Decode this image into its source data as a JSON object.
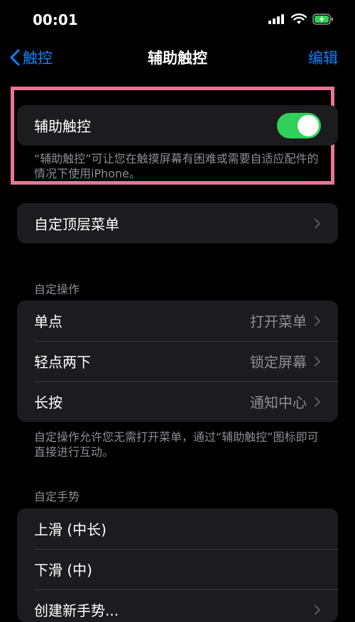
{
  "status_bar": {
    "time": "00:01",
    "icons": [
      "signal-icon",
      "wifi-icon",
      "battery-charging-icon"
    ],
    "battery_color": "#30d158"
  },
  "nav": {
    "back_label": "触控",
    "title": "辅助触控",
    "edit_label": "编辑"
  },
  "assistive_touch": {
    "label": "辅助触控",
    "enabled": true,
    "description": "“辅助触控”可让您在触摸屏幕有困难或需要自适应配件的情况下使用iPhone。"
  },
  "top_menu": {
    "label": "自定顶层菜单"
  },
  "custom_actions": {
    "header": "自定操作",
    "rows": [
      {
        "label": "单点",
        "value": "打开菜单"
      },
      {
        "label": "轻点两下",
        "value": "锁定屏幕"
      },
      {
        "label": "长按",
        "value": "通知中心"
      }
    ],
    "footer": "自定操作允许您无需打开菜单，通过“辅助触控”图标即可直接进行互动。"
  },
  "custom_gestures": {
    "header": "自定手势",
    "rows": [
      {
        "label": "上滑 (中长)"
      },
      {
        "label": "下滑 (中)"
      },
      {
        "label": "创建新手势..."
      }
    ]
  },
  "colors": {
    "accent": "#0a84ff",
    "toggle_on": "#30d158",
    "highlight_border": "#e97594",
    "group_bg": "#1c1c1e"
  }
}
